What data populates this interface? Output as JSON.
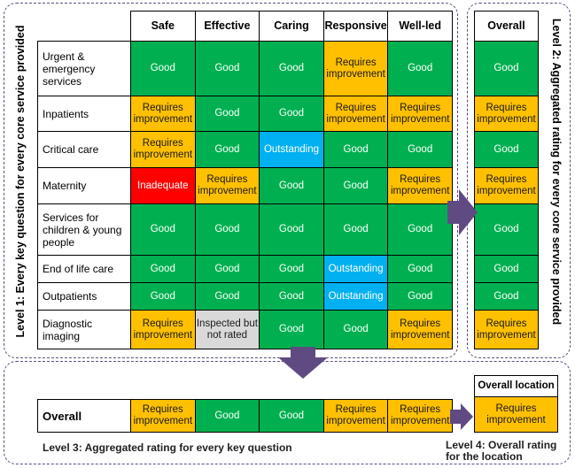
{
  "colors": {
    "good": "#00b050",
    "requires_improvement": "#ffc000",
    "outstanding": "#00b0f0",
    "inadequate": "#ff0000",
    "not_rated": "#d9d9d9",
    "arrow": "#5f4b82",
    "dashed_border": "#5a4d7a"
  },
  "level1": {
    "label": "Level 1: Every key question for every core service provided",
    "columns": [
      "Safe",
      "Effective",
      "Caring",
      "Responsive",
      "Well-led"
    ],
    "rows": [
      {
        "service": "Urgent & emergency services",
        "ratings": [
          "Good",
          "Good",
          "Good",
          "Requires improvement",
          "Good"
        ]
      },
      {
        "service": "Inpatients",
        "ratings": [
          "Requires improvement",
          "Good",
          "Good",
          "Requires improvement",
          "Requires improvement"
        ]
      },
      {
        "service": "Critical care",
        "ratings": [
          "Requires improvement",
          "Good",
          "Outstanding",
          "Good",
          "Good"
        ]
      },
      {
        "service": "Maternity",
        "ratings": [
          "Inadequate",
          "Requires improvement",
          "Good",
          "Good",
          "Requires improvement"
        ]
      },
      {
        "service": "Services for children & young people",
        "ratings": [
          "Good",
          "Good",
          "Good",
          "Good",
          "Good"
        ]
      },
      {
        "service": "End of life care",
        "ratings": [
          "Good",
          "Good",
          "Good",
          "Outstanding",
          "Good"
        ]
      },
      {
        "service": "Outpatients",
        "ratings": [
          "Good",
          "Good",
          "Good",
          "Outstanding",
          "Good"
        ]
      },
      {
        "service": "Diagnostic imaging",
        "ratings": [
          "Requires improvement",
          "Inspected but not rated",
          "Good",
          "Good",
          "Requires improvement"
        ]
      }
    ]
  },
  "level2": {
    "label": "Level 2: Aggregated rating for every core service provided",
    "header": "Overall",
    "ratings": [
      "Good",
      "Requires improvement",
      "Good",
      "Requires improvement",
      "Good",
      "Good",
      "Good",
      "Requires improvement"
    ]
  },
  "level3": {
    "label": "Overall",
    "caption": "Level 3: Aggregated rating for every key question",
    "ratings": [
      "Requires improvement",
      "Good",
      "Good",
      "Requires improvement",
      "Requires improvement"
    ]
  },
  "level4": {
    "header": "Overall location",
    "rating": "Requires improvement",
    "caption": "Level 4: Overall rating for the location"
  }
}
